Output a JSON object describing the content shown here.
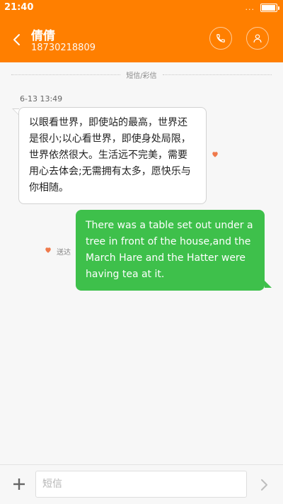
{
  "status_bar": {
    "time": "21:40",
    "signal_dots": "...",
    "battery_level": 0.85,
    "icons": [
      "more-dots-icon",
      "battery-icon"
    ]
  },
  "header": {
    "contact_name": "倩倩",
    "contact_number": "18730218809",
    "icons": [
      "back-arrow-icon",
      "phone-icon",
      "person-icon"
    ],
    "background": "#ff7f00"
  },
  "conversation": {
    "separator_label": "短信/彩信",
    "messages": [
      {
        "direction": "incoming",
        "timestamp": "6-13 13:49",
        "text": "以眼看世界，即使站的最高，世界还是很小;以心看世界，即使身处局限，世界依然很大。生活远不完美，需要用心去体会;无需拥有太多，愿快乐与你相随。",
        "bubble_color": "#ffffff",
        "favorite_icon": "heart-icon"
      },
      {
        "direction": "outgoing",
        "text": "There was a table set out under a tree in front of the house,and the March Hare and the Hatter were having tea at it.",
        "status": "送达",
        "bubble_color": "#3ec04b",
        "favorite_icon": "heart-icon"
      }
    ]
  },
  "composer": {
    "placeholder": "短信",
    "value": "",
    "icons": [
      "plus-icon",
      "send-arrow-icon"
    ]
  },
  "colors": {
    "accent": "#ff7f00",
    "outgoing_bubble": "#3ec04b",
    "heart": "#ef7a4c"
  }
}
